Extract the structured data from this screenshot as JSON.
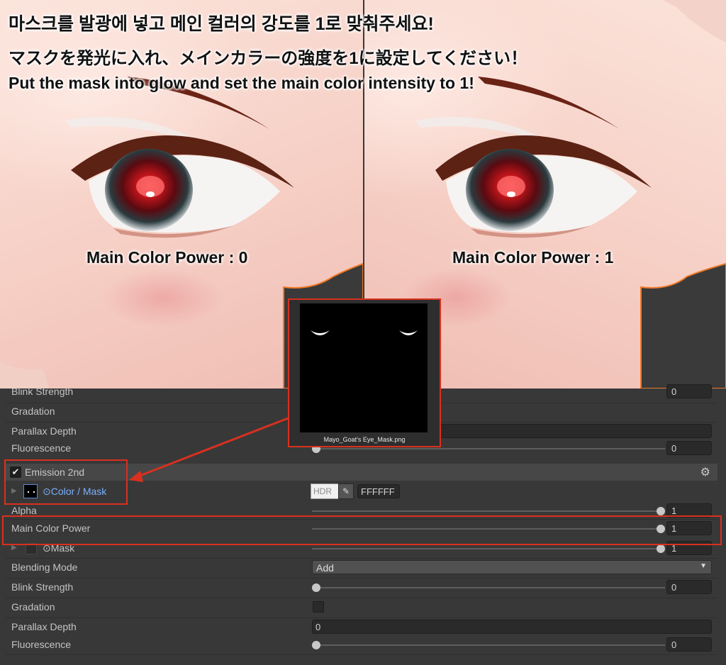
{
  "captions": {
    "korean": "마스크를 발광에 넣고 메인 컬러의 강도를 1로 맞춰주세요!",
    "japanese": "マスクを発光に入れ、メインカラーの強度を1に設定してください！",
    "english": "Put the mask into glow and set the main color intensity to 1!"
  },
  "previews": {
    "left_label": "Main Color Power : 0",
    "right_label": "Main Color Power : 1"
  },
  "mask_popup": {
    "filename": "Mayo_Goat's Eye_Mask.png"
  },
  "colors": {
    "highlight": "#d9301f",
    "link_label": "#7ab0ff",
    "panel_bg": "#383838"
  },
  "inspector": {
    "top": {
      "blink_strength": {
        "label": "Blink Strength",
        "value": "0",
        "level": 0
      },
      "gradation": {
        "label": "Gradation"
      },
      "parallax_depth": {
        "label": "Parallax Depth"
      },
      "fluorescence": {
        "label": "Fluorescence",
        "value": "0",
        "level": 0
      }
    },
    "emission2": {
      "title": "Emission 2nd",
      "enabled": true,
      "color_mask": {
        "label": "Color / Mask",
        "hdr": "HDR",
        "hex": "FFFFFF"
      },
      "alpha": {
        "label": "Alpha",
        "value": "1",
        "level": 1
      },
      "main_color_power": {
        "label": "Main Color Power",
        "value": "1",
        "level": 1
      },
      "mask": {
        "label": "Mask",
        "value": "1",
        "level": 1
      },
      "blending_mode": {
        "label": "Blending Mode",
        "value": "Add"
      },
      "blink_strength": {
        "label": "Blink Strength",
        "value": "0",
        "level": 0
      },
      "gradation": {
        "label": "Gradation",
        "checked": false
      },
      "parallax_depth": {
        "label": "Parallax Depth",
        "value": "0"
      },
      "fluorescence": {
        "label": "Fluorescence",
        "value": "0",
        "level": 0
      }
    }
  }
}
